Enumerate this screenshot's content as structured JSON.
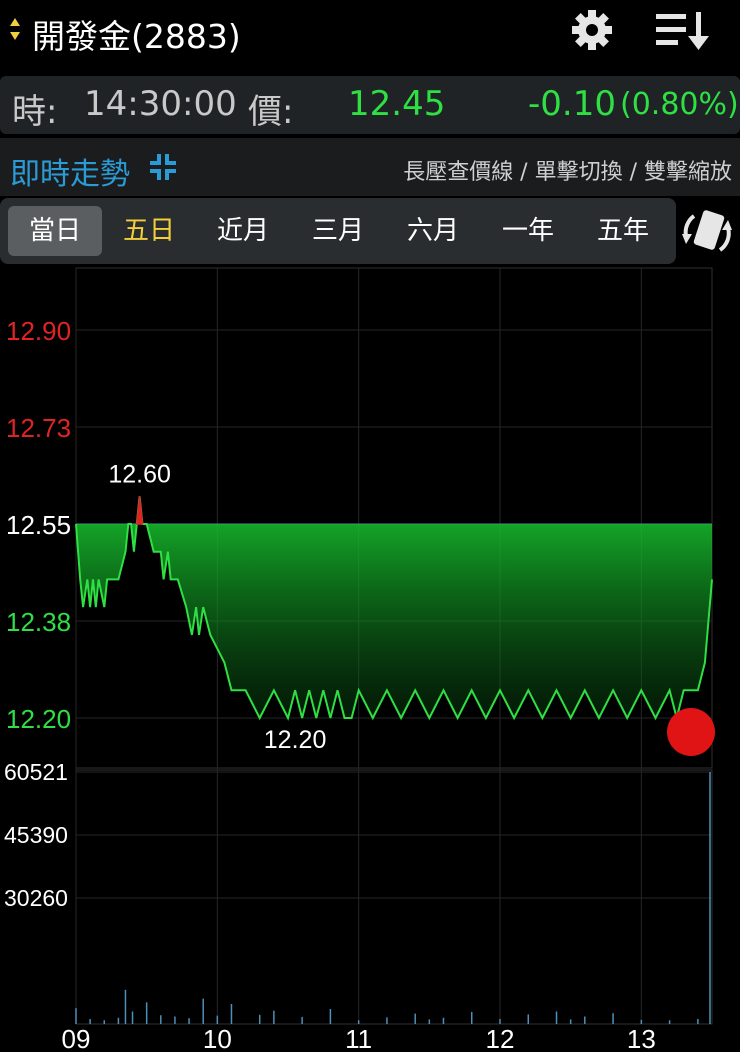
{
  "header": {
    "title": "開發金(2883)",
    "icons": [
      "updown-arrows-icon",
      "gear-icon",
      "sort-list-icon"
    ]
  },
  "quote": {
    "time_label": "時:",
    "time": "14:30:00",
    "price_label": "價:",
    "price": "12.45",
    "change": "-0.10",
    "change_pct": "(0.80%)"
  },
  "section": {
    "title": "即時走勢",
    "hint": "長壓查價線 / 單擊切換 / 雙擊縮放"
  },
  "tabs": [
    {
      "label": "當日",
      "state": "active"
    },
    {
      "label": "五日",
      "state": "highlight"
    },
    {
      "label": "近月",
      "state": ""
    },
    {
      "label": "三月",
      "state": ""
    },
    {
      "label": "六月",
      "state": ""
    },
    {
      "label": "一年",
      "state": ""
    },
    {
      "label": "五年",
      "state": ""
    }
  ],
  "colors": {
    "up": "#e02424",
    "down": "#2ee043",
    "neutral": "#ffffff",
    "accent": "#2b9bd6",
    "highlight_tab": "#f3cf3b",
    "volume": "#4f8fb8",
    "grid": "#262626"
  },
  "chart_data": {
    "type": "line",
    "reference_price": 12.55,
    "price_axis": {
      "range": [
        12.2,
        12.9
      ],
      "ticks": [
        {
          "label": "12.90",
          "value": 12.9,
          "color": "up"
        },
        {
          "label": "12.73",
          "value": 12.725,
          "color": "up"
        },
        {
          "label": "12.55",
          "value": 12.55,
          "color": "neutral"
        },
        {
          "label": "12.38",
          "value": 12.375,
          "color": "down"
        },
        {
          "label": "12.20",
          "value": 12.2,
          "color": "down"
        }
      ]
    },
    "time_axis": {
      "range": [
        9.0,
        13.5
      ],
      "ticks": [
        {
          "label": "09",
          "value": 9
        },
        {
          "label": "10",
          "value": 10
        },
        {
          "label": "11",
          "value": 11
        },
        {
          "label": "12",
          "value": 12
        },
        {
          "label": "13",
          "value": 13
        }
      ]
    },
    "price_series": {
      "x": [
        9.0,
        9.03,
        9.05,
        9.08,
        9.1,
        9.12,
        9.14,
        9.16,
        9.2,
        9.22,
        9.25,
        9.3,
        9.35,
        9.37,
        9.39,
        9.41,
        9.43,
        9.45,
        9.47,
        9.5,
        9.55,
        9.6,
        9.62,
        9.65,
        9.67,
        9.72,
        9.78,
        9.82,
        9.85,
        9.87,
        9.9,
        9.95,
        10.05,
        10.1,
        10.2,
        10.3,
        10.4,
        10.5,
        10.55,
        10.6,
        10.65,
        10.7,
        10.75,
        10.8,
        10.85,
        10.9,
        10.95,
        11.0,
        11.1,
        11.2,
        11.3,
        11.4,
        11.5,
        11.6,
        11.7,
        11.8,
        11.9,
        12.0,
        12.1,
        12.2,
        12.3,
        12.4,
        12.5,
        12.6,
        12.7,
        12.8,
        12.9,
        13.0,
        13.1,
        13.2,
        13.25,
        13.3,
        13.35,
        13.4,
        13.45,
        13.5
      ],
      "y": [
        12.55,
        12.45,
        12.4,
        12.45,
        12.4,
        12.45,
        12.4,
        12.45,
        12.4,
        12.45,
        12.45,
        12.45,
        12.5,
        12.55,
        12.55,
        12.5,
        12.55,
        12.6,
        12.55,
        12.55,
        12.5,
        12.5,
        12.45,
        12.5,
        12.45,
        12.45,
        12.4,
        12.35,
        12.4,
        12.35,
        12.4,
        12.35,
        12.3,
        12.25,
        12.25,
        12.2,
        12.25,
        12.2,
        12.25,
        12.2,
        12.25,
        12.2,
        12.25,
        12.2,
        12.25,
        12.2,
        12.2,
        12.25,
        12.2,
        12.25,
        12.2,
        12.25,
        12.2,
        12.25,
        12.2,
        12.25,
        12.2,
        12.25,
        12.2,
        12.25,
        12.2,
        12.25,
        12.2,
        12.25,
        12.2,
        12.25,
        12.2,
        12.25,
        12.2,
        12.25,
        12.2,
        12.25,
        12.25,
        12.25,
        12.3,
        12.45
      ]
    },
    "annotations": {
      "high": {
        "label": "12.60",
        "x": 9.45,
        "y": 12.6
      },
      "low": {
        "label": "12.20",
        "x": 10.55,
        "y": 12.2
      }
    },
    "last_point": {
      "x": 13.5,
      "y": 12.45
    },
    "volume_axis": {
      "range": [
        0,
        60521
      ],
      "ticks": [
        {
          "label": "60521",
          "value": 60521
        },
        {
          "label": "45390",
          "value": 45390
        },
        {
          "label": "30260",
          "value": 30260
        }
      ]
    },
    "volume_series": {
      "x": [
        9.0,
        9.1,
        9.2,
        9.3,
        9.35,
        9.4,
        9.5,
        9.6,
        9.7,
        9.8,
        9.9,
        10.0,
        10.1,
        10.3,
        10.4,
        10.6,
        10.8,
        11.0,
        11.2,
        11.4,
        11.5,
        11.6,
        11.8,
        12.0,
        12.2,
        12.4,
        12.5,
        12.6,
        12.8,
        13.0,
        13.2,
        13.4,
        13.5
      ],
      "y": [
        3800,
        1200,
        900,
        1500,
        8200,
        3000,
        5200,
        2100,
        1800,
        1400,
        6100,
        2000,
        4800,
        2200,
        3200,
        1700,
        3600,
        900,
        1600,
        2500,
        1100,
        1500,
        2900,
        1200,
        2300,
        3000,
        1100,
        1800,
        2600,
        1000,
        900,
        1200,
        60521
      ]
    }
  }
}
